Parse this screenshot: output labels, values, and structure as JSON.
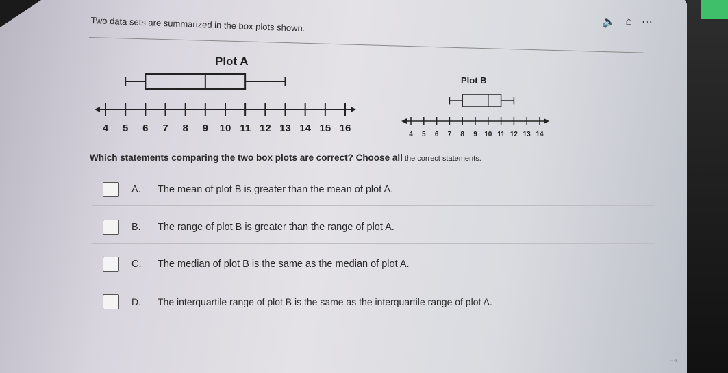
{
  "prompt": "Two data sets are summarized in the box plots shown.",
  "plot_a": {
    "title": "Plot A",
    "ticks": [
      "4",
      "5",
      "6",
      "7",
      "8",
      "9",
      "10",
      "11",
      "12",
      "13",
      "14",
      "15",
      "16"
    ],
    "box": {
      "min": 5,
      "q1": 6,
      "median": 9,
      "q3": 11,
      "max": 13
    }
  },
  "plot_b": {
    "title": "Plot B",
    "ticks": [
      "4",
      "5",
      "6",
      "7",
      "8",
      "9",
      "10",
      "11",
      "12",
      "13",
      "14"
    ],
    "box": {
      "min": 7,
      "q1": 8,
      "median": 10,
      "q3": 11,
      "max": 12
    }
  },
  "question": {
    "text": "Which statements comparing the two box plots are correct? Choose ",
    "emph": "all",
    "tail": " the correct statements."
  },
  "options": [
    {
      "letter": "A.",
      "text": "The mean of plot B is greater than the mean of plot A."
    },
    {
      "letter": "B.",
      "text": "The range of plot B is greater than the range of plot A."
    },
    {
      "letter": "C.",
      "text": "The median of plot B is the same as the median of plot A."
    },
    {
      "letter": "D.",
      "text": "The interquartile range of plot B is the same as the interquartile range of plot A."
    }
  ],
  "icons": [
    "speaker-icon",
    "bookmark-icon",
    "more-icon",
    "next-arrow-icon"
  ]
}
